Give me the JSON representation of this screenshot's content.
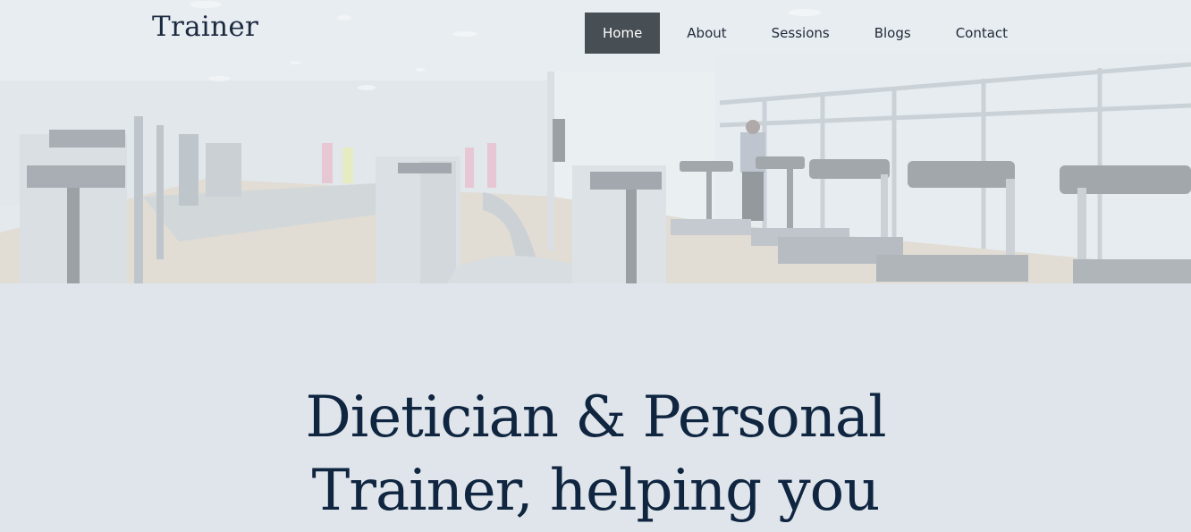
{
  "brand": {
    "title": "Trainer"
  },
  "nav": {
    "items": [
      {
        "label": "Home",
        "active": true
      },
      {
        "label": "About",
        "active": false
      },
      {
        "label": "Sessions",
        "active": false
      },
      {
        "label": "Blogs",
        "active": false
      },
      {
        "label": "Contact",
        "active": false
      }
    ]
  },
  "hero": {
    "image": "gym-interior-with-treadmills",
    "headline_line1": "Dietician & Personal",
    "headline_line2": "Trainer, helping you"
  },
  "colors": {
    "active_nav_bg": "#474f54",
    "headline": "#0f2540",
    "page_bg": "#dfe5ea"
  }
}
